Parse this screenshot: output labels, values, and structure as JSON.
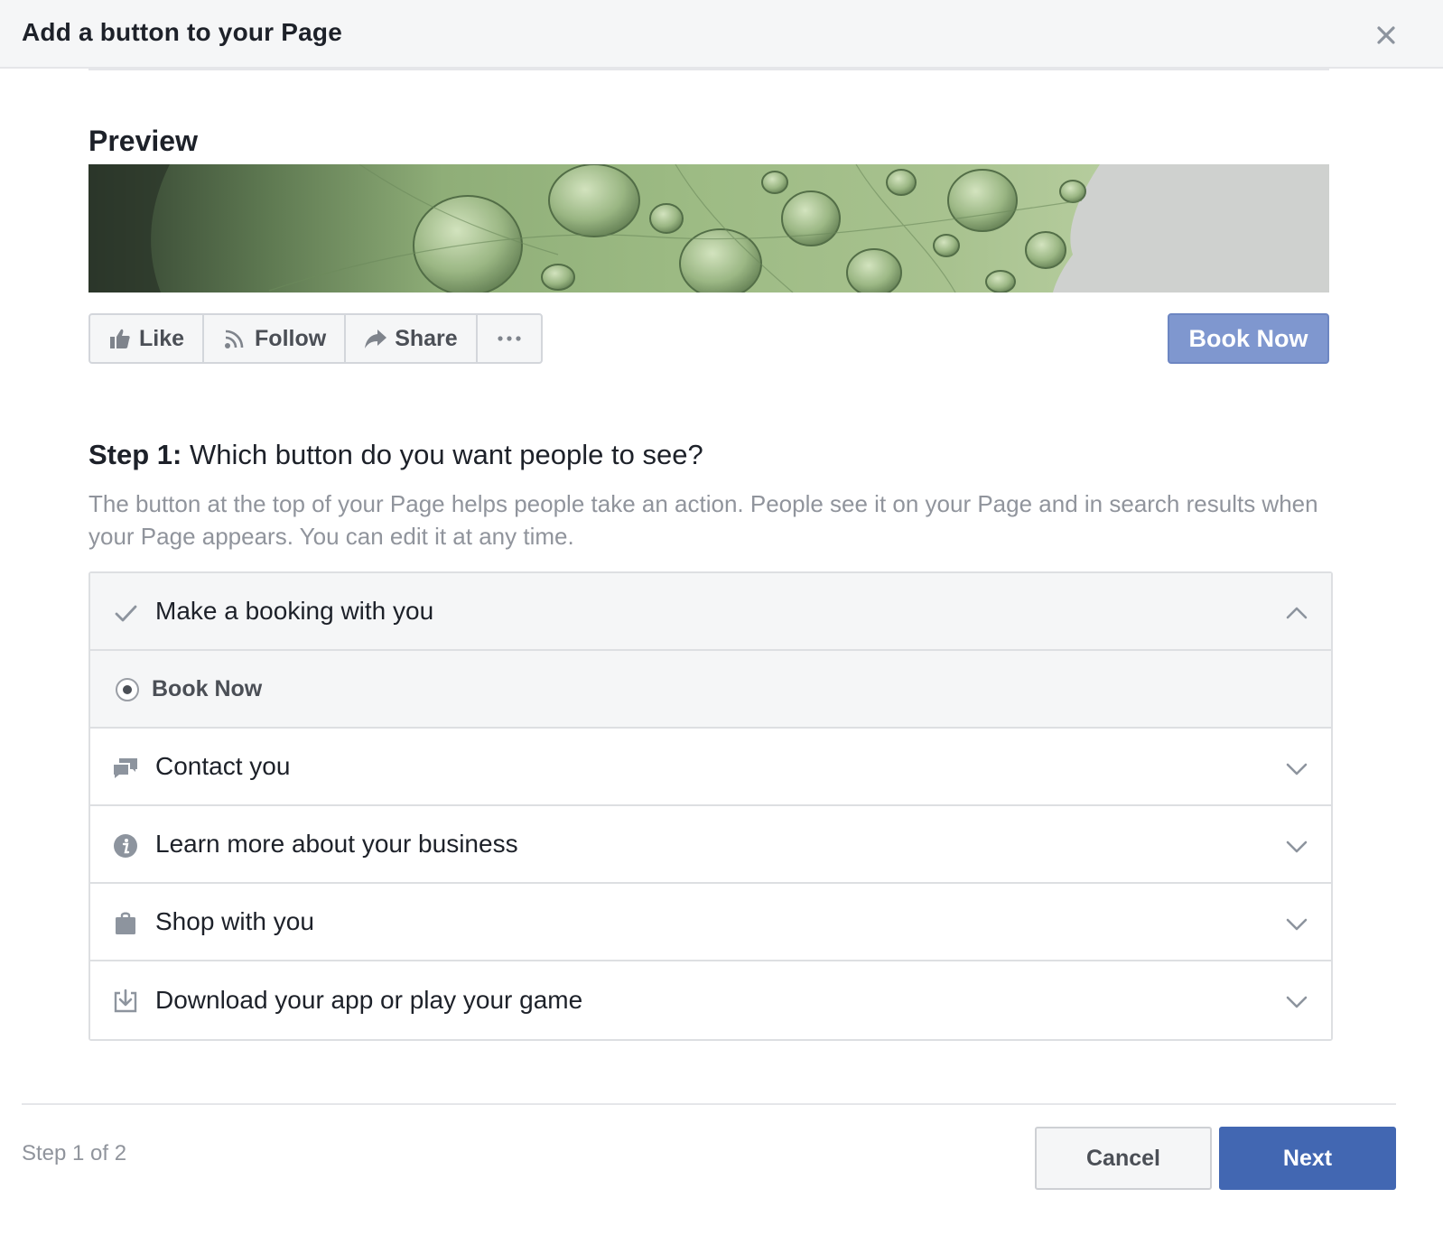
{
  "dialog": {
    "title": "Add a button to your Page",
    "close_icon": "close-icon"
  },
  "preview": {
    "label": "Preview",
    "actions": [
      {
        "label": "Like",
        "icon": "thumbs-up-icon"
      },
      {
        "label": "Follow",
        "icon": "rss-icon"
      },
      {
        "label": "Share",
        "icon": "share-arrow-icon"
      },
      {
        "label": "",
        "icon": "more-dots-icon"
      }
    ],
    "cta_label": "Book Now"
  },
  "step": {
    "prefix": "Step 1:",
    "question": " Which button do you want people to see?",
    "description": "The button at the top of your Page helps people take an action. People see it on your Page and in search results when your Page appears. You can edit it at any time."
  },
  "options": [
    {
      "label": "Make a booking with you",
      "icon": "check-icon",
      "expanded": true,
      "sub_option": {
        "label": "Book Now",
        "selected": true
      }
    },
    {
      "label": "Contact you",
      "icon": "chat-bubbles-icon",
      "expanded": false
    },
    {
      "label": "Learn more about your business",
      "icon": "info-icon",
      "expanded": false
    },
    {
      "label": "Shop with you",
      "icon": "shopping-bag-icon",
      "expanded": false
    },
    {
      "label": "Download your app or play your game",
      "icon": "download-icon",
      "expanded": false
    }
  ],
  "footer": {
    "step_count": "Step 1 of 2",
    "cancel_label": "Cancel",
    "next_label": "Next"
  },
  "colors": {
    "primary_blue": "#4267b2",
    "preview_cta_blue": "#7f97cf",
    "muted_text": "#90949c"
  }
}
